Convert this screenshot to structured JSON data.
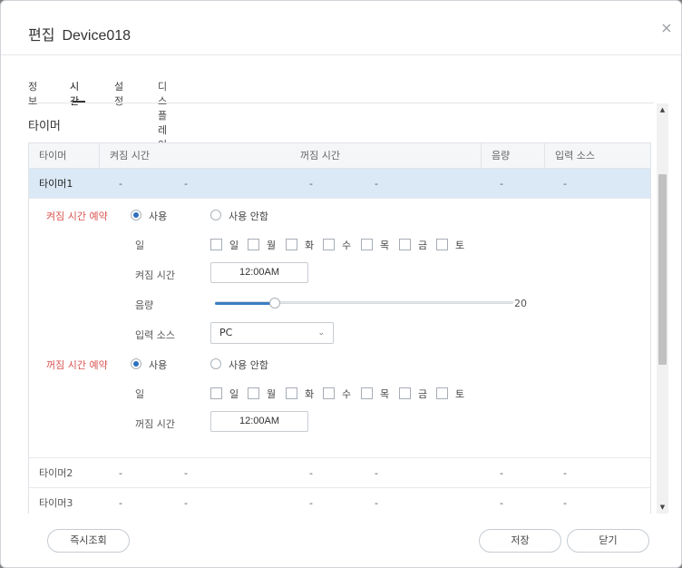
{
  "dialog": {
    "title_prefix": "편집",
    "device_name": "Device018",
    "close_symbol": "×"
  },
  "tabs": [
    {
      "label": "정보",
      "active": false
    },
    {
      "label": "시간",
      "active": true
    },
    {
      "label": "설정",
      "active": false
    },
    {
      "label": "디스플레이",
      "active": false
    }
  ],
  "section_title": "타이머",
  "table": {
    "headers": [
      "타이머",
      "켜짐 시간",
      "꺼짐 시간",
      "음량",
      "입력 소스"
    ],
    "rows": [
      {
        "name": "타이머1",
        "on_day": "-",
        "on_time": "-",
        "off_day": "-",
        "off_time": "-",
        "volume": "-",
        "source": "-"
      },
      {
        "name": "타이머2",
        "on_day": "-",
        "on_time": "-",
        "off_day": "-",
        "off_time": "-",
        "volume": "-",
        "source": "-"
      },
      {
        "name": "타이머3",
        "on_day": "-",
        "on_time": "-",
        "off_day": "-",
        "off_time": "-",
        "volume": "-",
        "source": "-"
      }
    ]
  },
  "detail": {
    "on_schedule_label": "켜짐 시간 예약",
    "off_schedule_label": "꺼짐 시간 예약",
    "use_label": "사용",
    "not_use_label": "사용 안함",
    "day_label": "일",
    "days": [
      "일",
      "월",
      "화",
      "수",
      "목",
      "금",
      "토"
    ],
    "on_time_label": "켜짐 시간",
    "on_time_value": "12:00AM",
    "volume_label": "음량",
    "volume_value": "20",
    "volume_fraction": 0.2,
    "source_label": "입력 소스",
    "source_value": "PC",
    "off_time_label": "꺼짐 시간",
    "off_time_value": "12:00AM"
  },
  "footer": {
    "refresh_label": "즉시조회",
    "save_label": "저장",
    "close_label": "닫기"
  },
  "colors": {
    "accent": "#2e6fbf",
    "schedule_label": "#d9534f",
    "selected_row": "#dbe9f6"
  }
}
